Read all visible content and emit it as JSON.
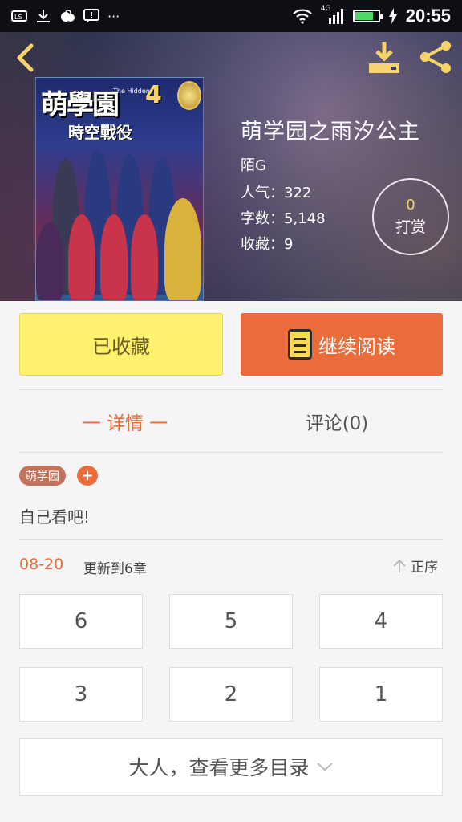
{
  "status_bar": {
    "time": "20:55",
    "network": "4G",
    "icons": [
      "notification-icon",
      "download-icon",
      "cloud-icon",
      "message-icon",
      "more-icon",
      "wifi-icon",
      "signal-icon",
      "battery-icon",
      "charging-icon"
    ],
    "battery_level": 0.8,
    "more_glyph": "···"
  },
  "header": {
    "cover": {
      "title_text": "萌學園",
      "number": "4",
      "subtitle": "時空戰役",
      "english": "The Hidden"
    },
    "book_title": "萌学园之雨汐公主",
    "author": "陌G",
    "popularity": "人气：322",
    "word_count": "字数：5,148",
    "favorites": "收藏：9",
    "reward": {
      "count": "0",
      "label": "打赏"
    }
  },
  "actions": {
    "favorite_label": "已收藏",
    "read_label": "继续阅读"
  },
  "tabs": {
    "detail": "一 详情 一",
    "comments": "评论(0)"
  },
  "tags": [
    "萌学园"
  ],
  "tag_add": "+",
  "description": "自己看吧!",
  "update": {
    "date": "08-20",
    "text": "更新到6章",
    "sort_label": "正序"
  },
  "chapters": [
    "6",
    "5",
    "4",
    "3",
    "2",
    "1"
  ],
  "more_label": "大人，查看更多目录",
  "colors": {
    "accent": "#ea6c3b",
    "favorite_bg": "#fdf16d",
    "tag_bg": "#c1735c",
    "icon_yellow": "#f6d36b"
  }
}
